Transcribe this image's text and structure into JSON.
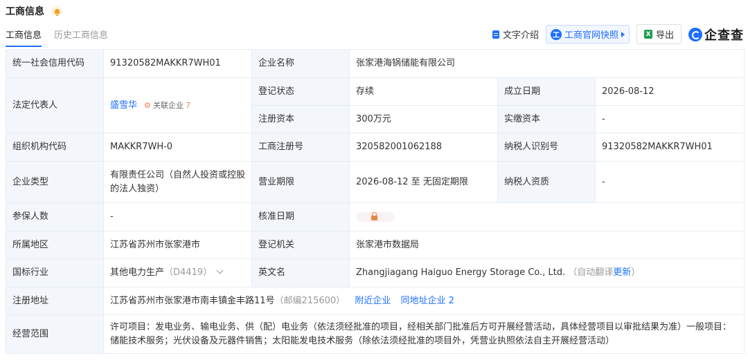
{
  "header": {
    "title": "工商信息"
  },
  "tabs": [
    {
      "label": "工商信息"
    },
    {
      "label": "历史工商信息"
    }
  ],
  "toolbar": {
    "text_intro": "文字介绍",
    "snapshot": "工商官网快照",
    "export": "导出",
    "logo_text": "企查查"
  },
  "rows": {
    "credit_code": {
      "label": "统一社会信用代码",
      "value": "91320582MAKKR7WH01"
    },
    "company_name": {
      "label": "企业名称",
      "value": "张家港海锅储能有限公司"
    },
    "legal_rep": {
      "label": "法定代表人",
      "value": "盛雪华",
      "related_label": "关联企业",
      "related_count": "7"
    },
    "reg_status": {
      "label": "登记状态",
      "value": "存续"
    },
    "est_date": {
      "label": "成立日期",
      "value": "2026-08-12"
    },
    "reg_capital": {
      "label": "注册资本",
      "value": "300万元"
    },
    "paid_capital": {
      "label": "实缴资本",
      "value": "-"
    },
    "org_code": {
      "label": "组织机构代码",
      "value": "MAKKR7WH-0"
    },
    "reg_no": {
      "label": "工商注册号",
      "value": "320582001062188"
    },
    "taxpayer_id": {
      "label": "纳税人识别号",
      "value": "91320582MAKKR7WH01"
    },
    "company_type": {
      "label": "企业类型",
      "value": "有限责任公司（自然人投资或控股的法人独资）"
    },
    "term": {
      "label": "营业期限",
      "value": "2026-08-12 至 无固定期限"
    },
    "taxpayer_qual": {
      "label": "纳税人资质",
      "value": "-"
    },
    "insured": {
      "label": "参保人数",
      "value": "-"
    },
    "approval_date": {
      "label": "核准日期"
    },
    "region": {
      "label": "所属地区",
      "value": "江苏省苏州市张家港市"
    },
    "reg_authority": {
      "label": "登记机关",
      "value": "张家港市数据局"
    },
    "industry": {
      "label": "国标行业",
      "value": "其他电力生产",
      "code": "（D4419）"
    },
    "english_name": {
      "label": "英文名",
      "value": "Zhangjiagang Haiguo Energy Storage Co., Ltd.",
      "note": "（自动翻译",
      "update": "更新",
      "note_end": "）"
    },
    "address": {
      "label": "注册地址",
      "value": "江苏省苏州市张家港市南丰镇金丰路11号",
      "postcode": "（邮编215600）",
      "nearby": "附近企业",
      "same_addr": "同地址企业 2"
    },
    "scope": {
      "label": "经营范围",
      "value": "许可项目：发电业务、输电业务、供（配）电业务（依法须经批准的项目，经相关部门批准后方可开展经营活动，具体经营项目以审批结果为准）一般项目：储能技术服务；光伏设备及元器件销售；太阳能发电技术服务（除依法须经批准的项目外，凭营业执照依法自主开展经营活动）"
    }
  },
  "colors": {
    "accent": "#1e6fff",
    "label_bg": "#f3f6fb",
    "border": "#e6edf5",
    "tag_orange": "#ff7a45"
  }
}
